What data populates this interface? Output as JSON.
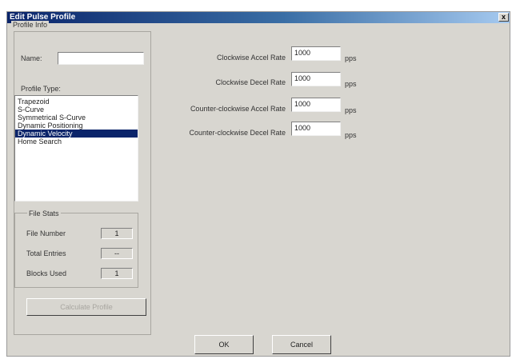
{
  "window": {
    "title": "Edit Pulse Profile",
    "close_label": "x"
  },
  "profile_info": {
    "group_label": "Profile Info",
    "name_label": "Name:",
    "name_value": "",
    "type_label": "Profile Type:",
    "types": [
      "Trapezoid",
      "S-Curve",
      "Symmetrical S-Curve",
      "Dynamic Positioning",
      "Dynamic Velocity",
      "Home Search"
    ],
    "selected_type": "Dynamic Velocity"
  },
  "file_stats": {
    "group_label": "File Stats",
    "rows": [
      {
        "label": "File Number",
        "value": "1"
      },
      {
        "label": "Total Entries",
        "value": "--"
      },
      {
        "label": "Blocks Used",
        "value": "1"
      }
    ]
  },
  "calculate_button": "Calculate Profile",
  "rates": [
    {
      "label": "Clockwise Accel Rate",
      "value": "1000",
      "unit": "pps"
    },
    {
      "label": "Clockwise Decel Rate",
      "value": "1000",
      "unit": "pps"
    },
    {
      "label": "Counter-clockwise Accel Rate",
      "value": "1000",
      "unit": "pps"
    },
    {
      "label": "Counter-clockwise Decel Rate",
      "value": "1000",
      "unit": "pps"
    }
  ],
  "buttons": {
    "ok": "OK",
    "cancel": "Cancel"
  }
}
